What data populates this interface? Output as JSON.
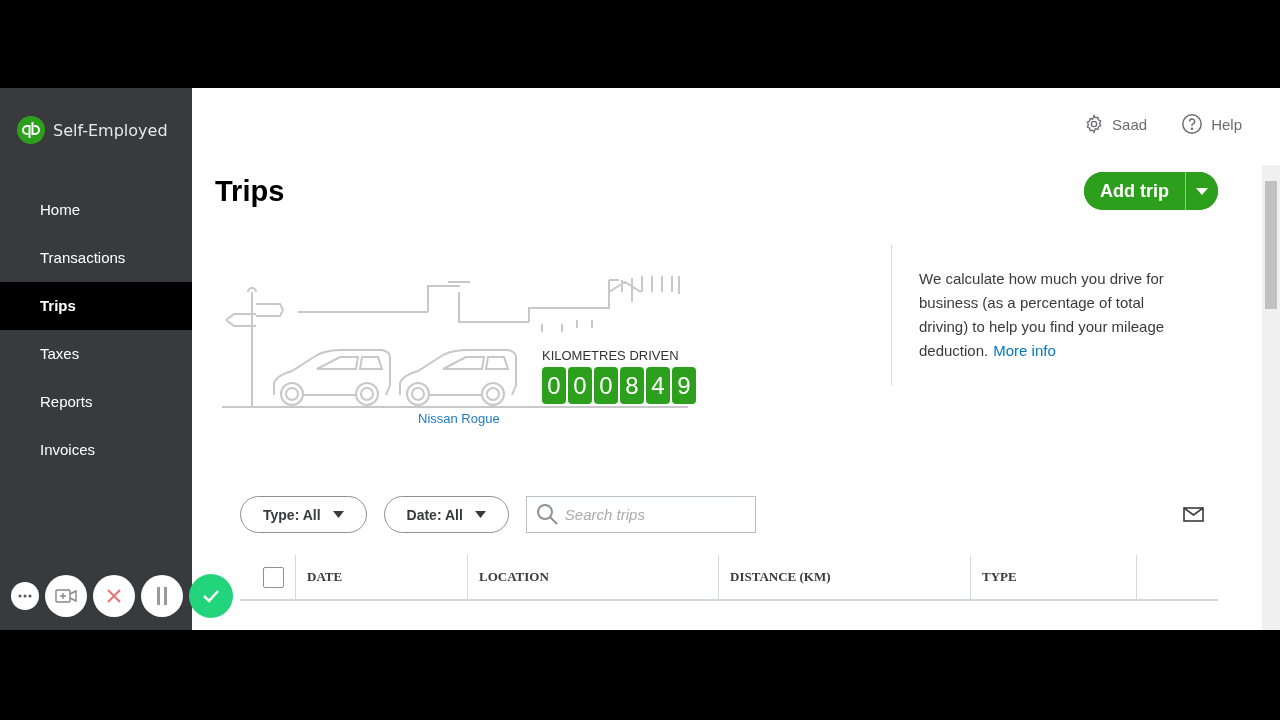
{
  "brand": {
    "name": "Self-Employed"
  },
  "sidebar": {
    "items": [
      {
        "label": "Home",
        "selected": false
      },
      {
        "label": "Transactions",
        "selected": false
      },
      {
        "label": "Trips",
        "selected": true
      },
      {
        "label": "Taxes",
        "selected": false
      },
      {
        "label": "Reports",
        "selected": false
      },
      {
        "label": "Invoices",
        "selected": false
      }
    ]
  },
  "header": {
    "user": "Saad",
    "help": "Help"
  },
  "page": {
    "title": "Trips",
    "add_button": "Add trip"
  },
  "odometer": {
    "label": "KILOMETRES DRIVEN",
    "digits": [
      "0",
      "0",
      "0",
      "8",
      "4",
      "9"
    ],
    "vehicle": "Nissan Rogue"
  },
  "info": {
    "text": "We calculate how much you drive for business (as a percentage of total driving) to help you find your mileage deduction.",
    "link": "More info"
  },
  "filters": [
    {
      "label": "Type: All"
    },
    {
      "label": "Date: All"
    }
  ],
  "search": {
    "placeholder": "Search trips"
  },
  "table": {
    "select_all": {
      "checked": false
    },
    "columns": [
      "DATE",
      "LOCATION",
      "DISTANCE (KM)",
      "TYPE"
    ]
  },
  "recorder": {
    "buttons": [
      {
        "kind": "more"
      },
      {
        "kind": "camera"
      },
      {
        "kind": "cancel"
      },
      {
        "kind": "pause"
      },
      {
        "kind": "done"
      }
    ]
  }
}
